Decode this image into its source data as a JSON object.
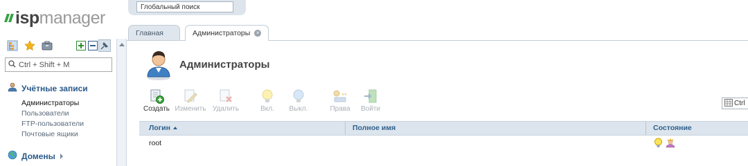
{
  "app": {
    "logo_isp": "isp",
    "logo_manager": "manager"
  },
  "global_search": {
    "placeholder": "Глобальный поиск"
  },
  "sidebar": {
    "toolbar": [
      {
        "icon": "tree-view-icon"
      },
      {
        "icon": "star-icon"
      },
      {
        "icon": "briefcase-icon"
      },
      {
        "icon": "expand-all-icon"
      },
      {
        "icon": "collapse-all-icon"
      },
      {
        "icon": "pin-icon"
      }
    ],
    "search": {
      "placeholder": "Ctrl + Shift + M"
    },
    "sections": [
      {
        "title": "Учётные записи",
        "icon": "users-icon",
        "items": [
          "Администраторы",
          "Пользователи",
          "FTP-пользователи",
          "Почтовые ящики"
        ],
        "active_index": 0
      },
      {
        "title": "Домены",
        "icon": "globe-icon"
      }
    ]
  },
  "tabs": [
    {
      "label": "Главная",
      "active": false
    },
    {
      "label": "Администраторы",
      "active": true,
      "closable": true
    }
  ],
  "page": {
    "title": "Администраторы",
    "icon": "admin-user-icon"
  },
  "toolbar": [
    {
      "label": "Создать",
      "icon": "create-user-icon",
      "enabled": true
    },
    {
      "label": "Изменить",
      "icon": "edit-icon",
      "enabled": false
    },
    {
      "label": "Удалить",
      "icon": "delete-icon",
      "enabled": false
    },
    {
      "label": "Вкл.",
      "icon": "bulb-on-icon",
      "enabled": false
    },
    {
      "label": "Выкл.",
      "icon": "bulb-off-icon",
      "enabled": false
    },
    {
      "label": "Права",
      "icon": "permissions-icon",
      "enabled": false
    },
    {
      "label": "Войти",
      "icon": "login-icon",
      "enabled": false
    }
  ],
  "filter": {
    "text": "Ctrl"
  },
  "table": {
    "columns": [
      "Логин",
      "Полное имя",
      "Состояние"
    ],
    "sort_column": 0,
    "rows": [
      {
        "login": "root",
        "full_name": "",
        "status_icons": [
          "bulb-on-icon",
          "superuser-icon"
        ]
      }
    ]
  },
  "colors": {
    "brand_green": "#37a244",
    "link_blue": "#2f5f8a",
    "header_bg": "#dce5ee"
  }
}
